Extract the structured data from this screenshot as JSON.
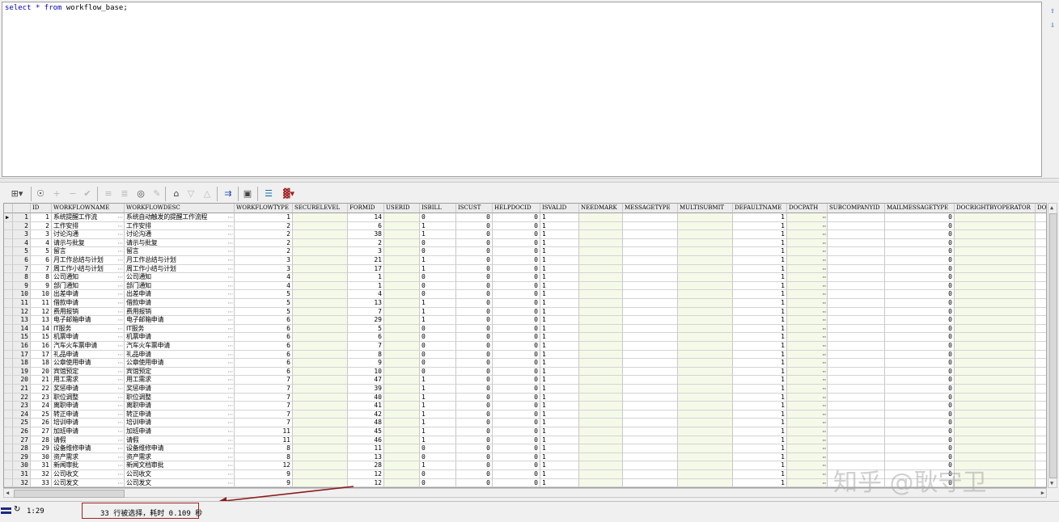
{
  "editor": {
    "sql_keyword1": "select",
    "sql_star": "*",
    "sql_keyword2": "from",
    "sql_table": "workflow_base;"
  },
  "toolbar": {
    "icons": [
      "grid-icon",
      "lock-icon",
      "add-row-icon",
      "delete-row-icon",
      "post-icon",
      "fetch-next-icon",
      "fetch-all-icon",
      "find-icon",
      "clear-icon",
      "query-icon",
      "filter-down-icon",
      "filter-up-icon",
      "explain-icon",
      "save-icon",
      "export-icon",
      "chart-icon"
    ]
  },
  "grid": {
    "columns": [
      "ID",
      "WORKFLOWNAME",
      "WORKFLOWDESC",
      "WORKFLOWTYPE",
      "SECURELEVEL",
      "FORMID",
      "USERID",
      "ISBILL",
      "ISCUST",
      "HELPDOCID",
      "ISVALID",
      "NEEDMARK",
      "MESSAGETYPE",
      "MULTISUBMIT",
      "DEFAULTNAME",
      "DOCPATH",
      "SUBCOMPANYID",
      "MAILMESSAGETYPE",
      "DOCRIGHTBYOPERATOR",
      "DOC"
    ],
    "rows": [
      {
        "n": "1",
        "id": "1",
        "name": "系统提醒工作流",
        "desc": "系统自动触发的提醒工作流程",
        "type": "1",
        "formid": "14",
        "isbill": "0",
        "iscust": "0",
        "helpdocid": "0",
        "isvalid": "1",
        "defaultname": "1",
        "mailtype": "0"
      },
      {
        "n": "2",
        "id": "2",
        "name": "工作安排",
        "desc": "工作安排",
        "type": "2",
        "formid": "6",
        "isbill": "1",
        "iscust": "0",
        "helpdocid": "0",
        "isvalid": "1",
        "defaultname": "1",
        "mailtype": "0"
      },
      {
        "n": "3",
        "id": "3",
        "name": "讨论沟通",
        "desc": "讨论沟通",
        "type": "2",
        "formid": "38",
        "isbill": "1",
        "iscust": "0",
        "helpdocid": "0",
        "isvalid": "1",
        "defaultname": "1",
        "mailtype": "0"
      },
      {
        "n": "4",
        "id": "4",
        "name": "请示与批复",
        "desc": "请示与批复",
        "type": "2",
        "formid": "2",
        "isbill": "0",
        "iscust": "0",
        "helpdocid": "0",
        "isvalid": "1",
        "defaultname": "1",
        "mailtype": "0"
      },
      {
        "n": "5",
        "id": "5",
        "name": "留言",
        "desc": "留言",
        "type": "2",
        "formid": "3",
        "isbill": "0",
        "iscust": "0",
        "helpdocid": "0",
        "isvalid": "1",
        "defaultname": "1",
        "mailtype": "0"
      },
      {
        "n": "6",
        "id": "6",
        "name": "月工作总结与计划",
        "desc": "月工作总结与计划",
        "type": "3",
        "formid": "21",
        "isbill": "1",
        "iscust": "0",
        "helpdocid": "0",
        "isvalid": "1",
        "defaultname": "1",
        "mailtype": "0"
      },
      {
        "n": "7",
        "id": "7",
        "name": "周工作小结与计划",
        "desc": "周工作小结与计划",
        "type": "3",
        "formid": "17",
        "isbill": "1",
        "iscust": "0",
        "helpdocid": "0",
        "isvalid": "1",
        "defaultname": "1",
        "mailtype": "0"
      },
      {
        "n": "8",
        "id": "8",
        "name": "公司通知",
        "desc": "公司通知",
        "type": "4",
        "formid": "1",
        "isbill": "0",
        "iscust": "0",
        "helpdocid": "0",
        "isvalid": "1",
        "defaultname": "1",
        "mailtype": "0"
      },
      {
        "n": "9",
        "id": "9",
        "name": "部门通知",
        "desc": "部门通知",
        "type": "4",
        "formid": "1",
        "isbill": "0",
        "iscust": "0",
        "helpdocid": "0",
        "isvalid": "1",
        "defaultname": "1",
        "mailtype": "0"
      },
      {
        "n": "10",
        "id": "10",
        "name": "出差申请",
        "desc": "出差申请",
        "type": "5",
        "formid": "4",
        "isbill": "0",
        "iscust": "0",
        "helpdocid": "0",
        "isvalid": "1",
        "defaultname": "1",
        "mailtype": "0"
      },
      {
        "n": "11",
        "id": "11",
        "name": "借款申请",
        "desc": "借款申请",
        "type": "5",
        "formid": "13",
        "isbill": "1",
        "iscust": "0",
        "helpdocid": "0",
        "isvalid": "1",
        "defaultname": "1",
        "mailtype": "0"
      },
      {
        "n": "12",
        "id": "12",
        "name": "费用报销",
        "desc": "费用报销",
        "type": "5",
        "formid": "7",
        "isbill": "1",
        "iscust": "0",
        "helpdocid": "0",
        "isvalid": "1",
        "defaultname": "1",
        "mailtype": "0"
      },
      {
        "n": "13",
        "id": "13",
        "name": "电子邮箱申请",
        "desc": "电子邮箱申请",
        "type": "6",
        "formid": "29",
        "isbill": "1",
        "iscust": "0",
        "helpdocid": "0",
        "isvalid": "1",
        "defaultname": "1",
        "mailtype": "0"
      },
      {
        "n": "14",
        "id": "14",
        "name": "IT服务",
        "desc": "IT服务",
        "type": "6",
        "formid": "5",
        "isbill": "0",
        "iscust": "0",
        "helpdocid": "0",
        "isvalid": "1",
        "defaultname": "1",
        "mailtype": "0"
      },
      {
        "n": "15",
        "id": "15",
        "name": "机票申请",
        "desc": "机票申请",
        "type": "6",
        "formid": "6",
        "isbill": "0",
        "iscust": "0",
        "helpdocid": "0",
        "isvalid": "1",
        "defaultname": "1",
        "mailtype": "0"
      },
      {
        "n": "16",
        "id": "16",
        "name": "汽车火车票申请",
        "desc": "汽车火车票申请",
        "type": "6",
        "formid": "7",
        "isbill": "0",
        "iscust": "0",
        "helpdocid": "0",
        "isvalid": "1",
        "defaultname": "1",
        "mailtype": "0"
      },
      {
        "n": "17",
        "id": "17",
        "name": "礼品申请",
        "desc": "礼品申请",
        "type": "6",
        "formid": "8",
        "isbill": "0",
        "iscust": "0",
        "helpdocid": "0",
        "isvalid": "1",
        "defaultname": "1",
        "mailtype": "0"
      },
      {
        "n": "18",
        "id": "18",
        "name": "公章使用申请",
        "desc": "公章使用申请",
        "type": "6",
        "formid": "9",
        "isbill": "0",
        "iscust": "0",
        "helpdocid": "0",
        "isvalid": "1",
        "defaultname": "1",
        "mailtype": "0"
      },
      {
        "n": "19",
        "id": "20",
        "name": "宾馆预定",
        "desc": "宾馆预定",
        "type": "6",
        "formid": "10",
        "isbill": "0",
        "iscust": "0",
        "helpdocid": "0",
        "isvalid": "1",
        "defaultname": "1",
        "mailtype": "0"
      },
      {
        "n": "20",
        "id": "21",
        "name": "用工需求",
        "desc": "用工需求",
        "type": "7",
        "formid": "47",
        "isbill": "1",
        "iscust": "0",
        "helpdocid": "0",
        "isvalid": "1",
        "defaultname": "1",
        "mailtype": "0"
      },
      {
        "n": "21",
        "id": "22",
        "name": "奖惩申请",
        "desc": "奖惩申请",
        "type": "7",
        "formid": "39",
        "isbill": "1",
        "iscust": "0",
        "helpdocid": "0",
        "isvalid": "1",
        "defaultname": "1",
        "mailtype": "0"
      },
      {
        "n": "22",
        "id": "23",
        "name": "职位调整",
        "desc": "职位调整",
        "type": "7",
        "formid": "40",
        "isbill": "1",
        "iscust": "0",
        "helpdocid": "0",
        "isvalid": "1",
        "defaultname": "1",
        "mailtype": "0"
      },
      {
        "n": "23",
        "id": "24",
        "name": "离职申请",
        "desc": "离职申请",
        "type": "7",
        "formid": "41",
        "isbill": "1",
        "iscust": "0",
        "helpdocid": "0",
        "isvalid": "1",
        "defaultname": "1",
        "mailtype": "0"
      },
      {
        "n": "24",
        "id": "25",
        "name": "转正申请",
        "desc": "转正申请",
        "type": "7",
        "formid": "42",
        "isbill": "1",
        "iscust": "0",
        "helpdocid": "0",
        "isvalid": "1",
        "defaultname": "1",
        "mailtype": "0"
      },
      {
        "n": "25",
        "id": "26",
        "name": "培训申请",
        "desc": "培训申请",
        "type": "7",
        "formid": "48",
        "isbill": "1",
        "iscust": "0",
        "helpdocid": "0",
        "isvalid": "1",
        "defaultname": "1",
        "mailtype": "0"
      },
      {
        "n": "26",
        "id": "27",
        "name": "加班申请",
        "desc": "加班申请",
        "type": "11",
        "formid": "45",
        "isbill": "1",
        "iscust": "0",
        "helpdocid": "0",
        "isvalid": "1",
        "defaultname": "1",
        "mailtype": "0"
      },
      {
        "n": "27",
        "id": "28",
        "name": "请假",
        "desc": "请假",
        "type": "11",
        "formid": "46",
        "isbill": "1",
        "iscust": "0",
        "helpdocid": "0",
        "isvalid": "1",
        "defaultname": "1",
        "mailtype": "0"
      },
      {
        "n": "28",
        "id": "29",
        "name": "设备维修申请",
        "desc": "设备维修申请",
        "type": "8",
        "formid": "11",
        "isbill": "0",
        "iscust": "0",
        "helpdocid": "0",
        "isvalid": "1",
        "defaultname": "1",
        "mailtype": "0"
      },
      {
        "n": "29",
        "id": "30",
        "name": "资产需求",
        "desc": "资产需求",
        "type": "8",
        "formid": "13",
        "isbill": "0",
        "iscust": "0",
        "helpdocid": "0",
        "isvalid": "1",
        "defaultname": "1",
        "mailtype": "0"
      },
      {
        "n": "30",
        "id": "31",
        "name": "新闻审批",
        "desc": "新闻文档审批",
        "type": "12",
        "formid": "28",
        "isbill": "1",
        "iscust": "0",
        "helpdocid": "0",
        "isvalid": "1",
        "defaultname": "1",
        "mailtype": "0"
      },
      {
        "n": "31",
        "id": "32",
        "name": "公司收文",
        "desc": "公司收文",
        "type": "9",
        "formid": "12",
        "isbill": "0",
        "iscust": "0",
        "helpdocid": "0",
        "isvalid": "1",
        "defaultname": "1",
        "mailtype": "0"
      },
      {
        "n": "32",
        "id": "33",
        "name": "公司发文",
        "desc": "公司发文",
        "type": "9",
        "formid": "12",
        "isbill": "0",
        "iscust": "0",
        "helpdocid": "0",
        "isvalid": "1",
        "defaultname": "1",
        "mailtype": "0"
      }
    ]
  },
  "status": {
    "position": "1:29",
    "message": "33 行被选择，耗时 0.109 秒"
  },
  "watermark": "知乎 @耿守卫",
  "colors": {
    "readonly_bg": "#f5f9e8",
    "annotation_red": "#a02020",
    "keyword_blue": "#0000c0"
  }
}
